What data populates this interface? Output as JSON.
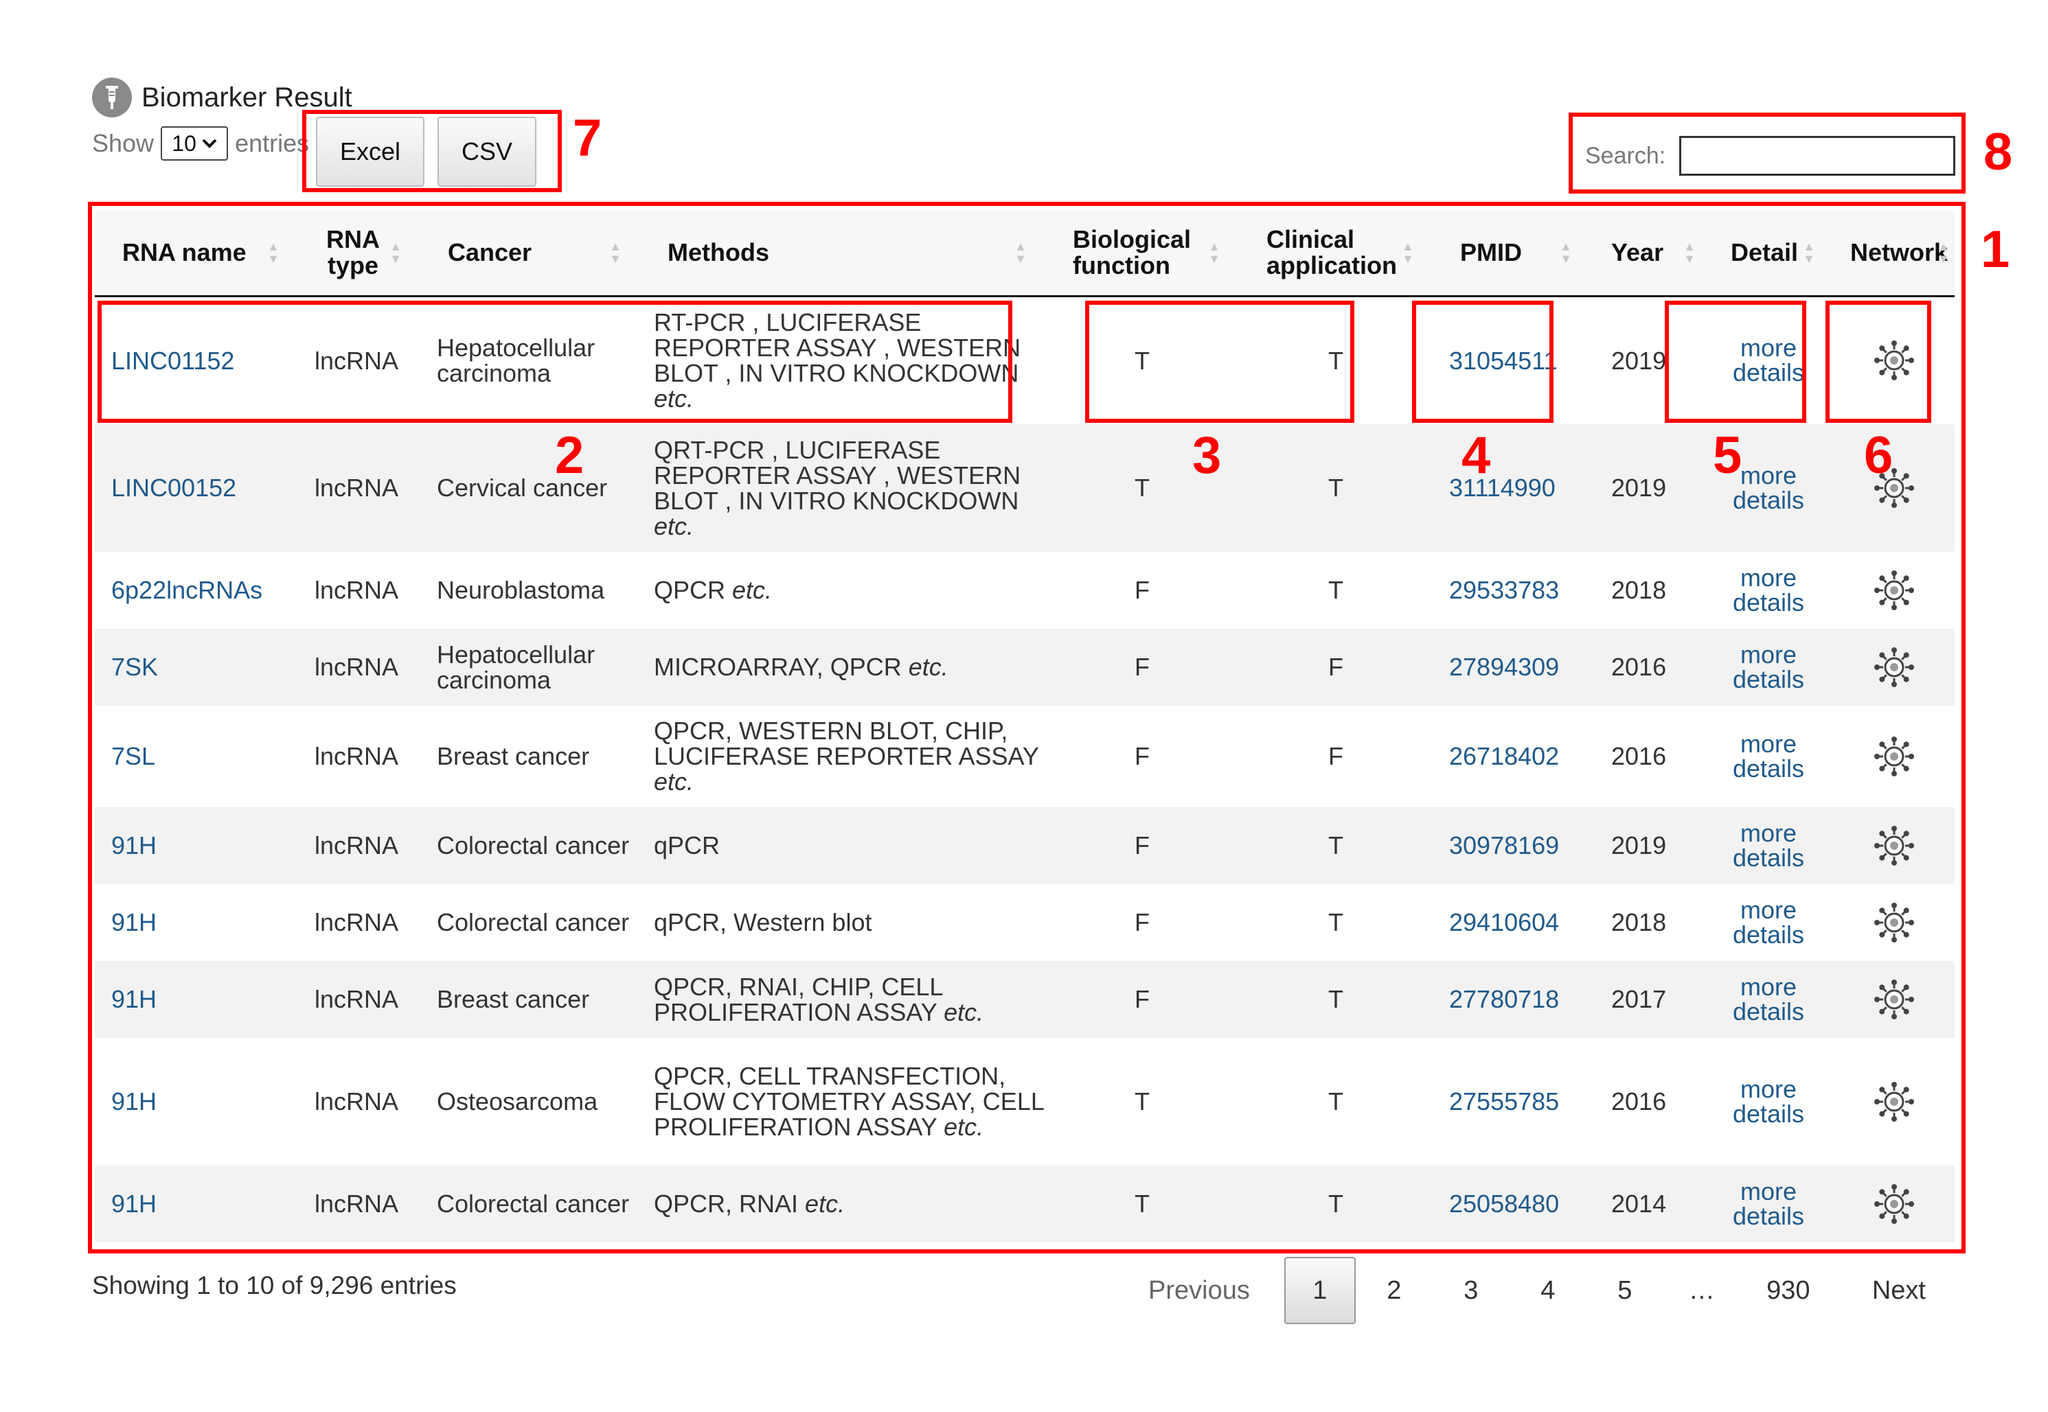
{
  "header": {
    "title": "Biomarker Result"
  },
  "length": {
    "show": "Show",
    "value": "10",
    "entries": "entries"
  },
  "buttons": {
    "excel": "Excel",
    "csv": "CSV"
  },
  "search": {
    "label": "Search:",
    "value": ""
  },
  "columns": [
    "RNA name",
    "RNA type",
    "Cancer",
    "Methods",
    "Biological function",
    "Clinical application",
    "PMID",
    "Year",
    "Detail",
    "Network"
  ],
  "rows": [
    {
      "rna": "LINC01152",
      "type": "lncRNA",
      "cancer": "Hepatocellular carcinoma",
      "methods": "RT-PCR , LUCIFERASE REPORTER ASSAY , WESTERN BLOT , IN VITRO KNOCKDOWN",
      "etc": "etc.",
      "bio": "T",
      "clin": "T",
      "pmid": "31054511",
      "year": "2019",
      "detail": "more details"
    },
    {
      "rna": "LINC00152",
      "type": "lncRNA",
      "cancer": "Cervical cancer",
      "methods": "QRT-PCR , LUCIFERASE REPORTER ASSAY , WESTERN BLOT , IN VITRO KNOCKDOWN",
      "etc": "etc.",
      "bio": "T",
      "clin": "T",
      "pmid": "31114990",
      "year": "2019",
      "detail": "more details"
    },
    {
      "rna": "6p22lncRNAs",
      "type": "lncRNA",
      "cancer": "Neuroblastoma",
      "methods": "QPCR",
      "etc": "etc.",
      "bio": "F",
      "clin": "T",
      "pmid": "29533783",
      "year": "2018",
      "detail": "more details"
    },
    {
      "rna": "7SK",
      "type": "lncRNA",
      "cancer": "Hepatocellular carcinoma",
      "methods": "MICROARRAY, QPCR",
      "etc": "etc.",
      "bio": "F",
      "clin": "F",
      "pmid": "27894309",
      "year": "2016",
      "detail": "more details"
    },
    {
      "rna": "7SL",
      "type": "lncRNA",
      "cancer": "Breast cancer",
      "methods": "QPCR, WESTERN BLOT, CHIP, LUCIFERASE REPORTER ASSAY",
      "etc": "etc.",
      "bio": "F",
      "clin": "F",
      "pmid": "26718402",
      "year": "2016",
      "detail": "more details"
    },
    {
      "rna": "91H",
      "type": "lncRNA",
      "cancer": "Colorectal cancer",
      "methods": "qPCR",
      "etc": "",
      "bio": "F",
      "clin": "T",
      "pmid": "30978169",
      "year": "2019",
      "detail": "more details"
    },
    {
      "rna": "91H",
      "type": "lncRNA",
      "cancer": "Colorectal cancer",
      "methods": "qPCR, Western blot",
      "etc": "",
      "bio": "F",
      "clin": "T",
      "pmid": "29410604",
      "year": "2018",
      "detail": "more details"
    },
    {
      "rna": "91H",
      "type": "lncRNA",
      "cancer": "Breast cancer",
      "methods": "QPCR, RNAI, CHIP, CELL PROLIFERATION ASSAY",
      "etc": "etc.",
      "bio": "F",
      "clin": "T",
      "pmid": "27780718",
      "year": "2017",
      "detail": "more details"
    },
    {
      "rna": "91H",
      "type": "lncRNA",
      "cancer": "Osteosarcoma",
      "methods": "QPCR, CELL TRANSFECTION, FLOW CYTOMETRY ASSAY, CELL PROLIFERATION ASSAY",
      "etc": "etc.",
      "bio": "T",
      "clin": "T",
      "pmid": "27555785",
      "year": "2016",
      "detail": "more details"
    },
    {
      "rna": "91H",
      "type": "lncRNA",
      "cancer": "Colorectal cancer",
      "methods": "QPCR, RNAI",
      "etc": "etc.",
      "bio": "T",
      "clin": "T",
      "pmid": "25058480",
      "year": "2014",
      "detail": "more details"
    }
  ],
  "footer": {
    "info": "Showing 1 to 10 of 9,296 entries"
  },
  "pagination": {
    "previous": "Previous",
    "pages": [
      "1",
      "2",
      "3",
      "4",
      "5",
      "…",
      "930"
    ],
    "current": "1",
    "next": "Next"
  },
  "annotations": [
    "1",
    "2",
    "3",
    "4",
    "5",
    "6",
    "7",
    "8"
  ],
  "colors": {
    "annotation": "#ff0000",
    "link": "#1e5a8c",
    "striped_row": "#f2f2f2"
  },
  "icons": {
    "title": "biomarker-icon",
    "network": "network-icon"
  }
}
